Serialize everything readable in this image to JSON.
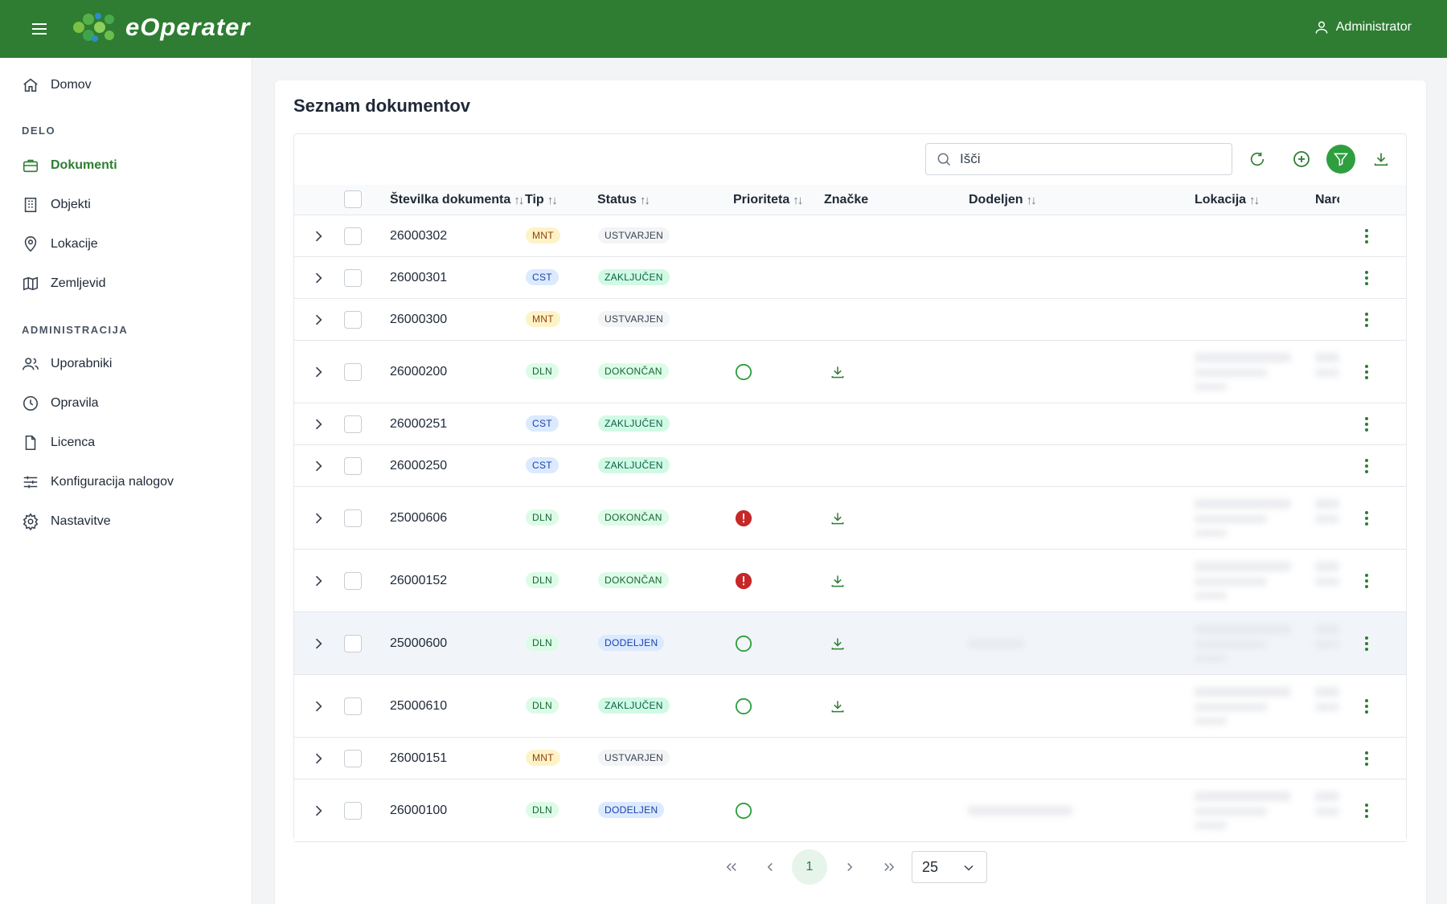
{
  "header": {
    "app_name": "eOperater",
    "user_label": "Administrator"
  },
  "sidebar": {
    "items": [
      {
        "label": "Domov",
        "icon": "home-icon"
      },
      {
        "label": "Dokumenti",
        "icon": "briefcase-icon",
        "active": true
      },
      {
        "label": "Objekti",
        "icon": "building-icon"
      },
      {
        "label": "Lokacije",
        "icon": "map-pin-icon"
      },
      {
        "label": "Zemljevid",
        "icon": "map-icon"
      },
      {
        "label": "Uporabniki",
        "icon": "users-icon"
      },
      {
        "label": "Opravila",
        "icon": "clock-icon"
      },
      {
        "label": "Licenca",
        "icon": "file-icon"
      },
      {
        "label": "Konfiguracija nalogov",
        "icon": "sliders-icon"
      },
      {
        "label": "Nastavitve",
        "icon": "gear-icon"
      }
    ],
    "sections": {
      "work": "DELO",
      "admin": "ADMINISTRACIJA"
    }
  },
  "main": {
    "title": "Seznam dokumentov",
    "search_placeholder": "Išči",
    "columns": {
      "number": "Številka dokumenta",
      "type": "Tip",
      "status": "Status",
      "priority": "Prioriteta",
      "tags": "Značke",
      "assigned": "Dodeljen",
      "location": "Lokacija",
      "customer": "Naro"
    },
    "rows": [
      {
        "number": "26000302",
        "type": "MNT",
        "status": "USTVARJEN",
        "status_class": "ustvarjen",
        "priority": "",
        "download": false
      },
      {
        "number": "26000301",
        "type": "CST",
        "status": "ZAKLJUČEN",
        "status_class": "zakljucen",
        "priority": "",
        "download": false
      },
      {
        "number": "26000300",
        "type": "MNT",
        "status": "USTVARJEN",
        "status_class": "ustvarjen",
        "priority": "",
        "download": false
      },
      {
        "number": "26000200",
        "type": "DLN",
        "status": "DOKONČAN",
        "status_class": "dokoncan",
        "priority": "normal",
        "download": true
      },
      {
        "number": "26000251",
        "type": "CST",
        "status": "ZAKLJUČEN",
        "status_class": "zakljucen",
        "priority": "",
        "download": false
      },
      {
        "number": "26000250",
        "type": "CST",
        "status": "ZAKLJUČEN",
        "status_class": "zakljucen",
        "priority": "",
        "download": false
      },
      {
        "number": "25000606",
        "type": "DLN",
        "status": "DOKONČAN",
        "status_class": "dokoncan",
        "priority": "high",
        "download": true
      },
      {
        "number": "26000152",
        "type": "DLN",
        "status": "DOKONČAN",
        "status_class": "dokoncan",
        "priority": "high",
        "download": true
      },
      {
        "number": "25000600",
        "type": "DLN",
        "status": "DODELJEN",
        "status_class": "dodeljen",
        "priority": "normal",
        "download": true
      },
      {
        "number": "25000610",
        "type": "DLN",
        "status": "ZAKLJUČEN",
        "status_class": "zakljucen",
        "priority": "normal",
        "download": true
      },
      {
        "number": "26000151",
        "type": "MNT",
        "status": "USTVARJEN",
        "status_class": "ustvarjen",
        "priority": "",
        "download": false
      },
      {
        "number": "26000100",
        "type": "DLN",
        "status": "DODELJEN",
        "status_class": "dodeljen",
        "priority": "normal",
        "download": false
      }
    ]
  },
  "pagination": {
    "current_page": "1",
    "per_page": "25"
  },
  "colors": {
    "brand": "#2e7d32",
    "accent": "#2e9e3e",
    "priority_high": "#c62828"
  }
}
